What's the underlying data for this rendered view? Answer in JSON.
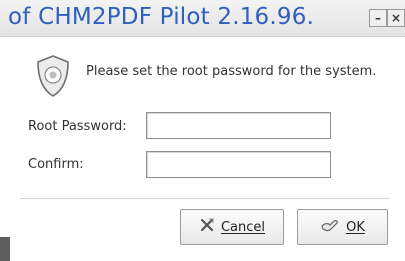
{
  "window": {
    "title": "of CHM2PDF Pilot 2.16.96.",
    "minimize_glyph": "–",
    "close_glyph": "×",
    "title_color": "#2f5fbf"
  },
  "prompt": {
    "icon": "shield-badge-icon",
    "text": "Please set the root password for the system."
  },
  "form": {
    "root_password": {
      "label": "Root Password:",
      "value": ""
    },
    "confirm": {
      "label": "Confirm:",
      "value": ""
    }
  },
  "buttons": {
    "cancel": {
      "label": "Cancel",
      "icon": "cancel-icon"
    },
    "ok": {
      "label": "OK",
      "icon": "ok-icon"
    }
  }
}
